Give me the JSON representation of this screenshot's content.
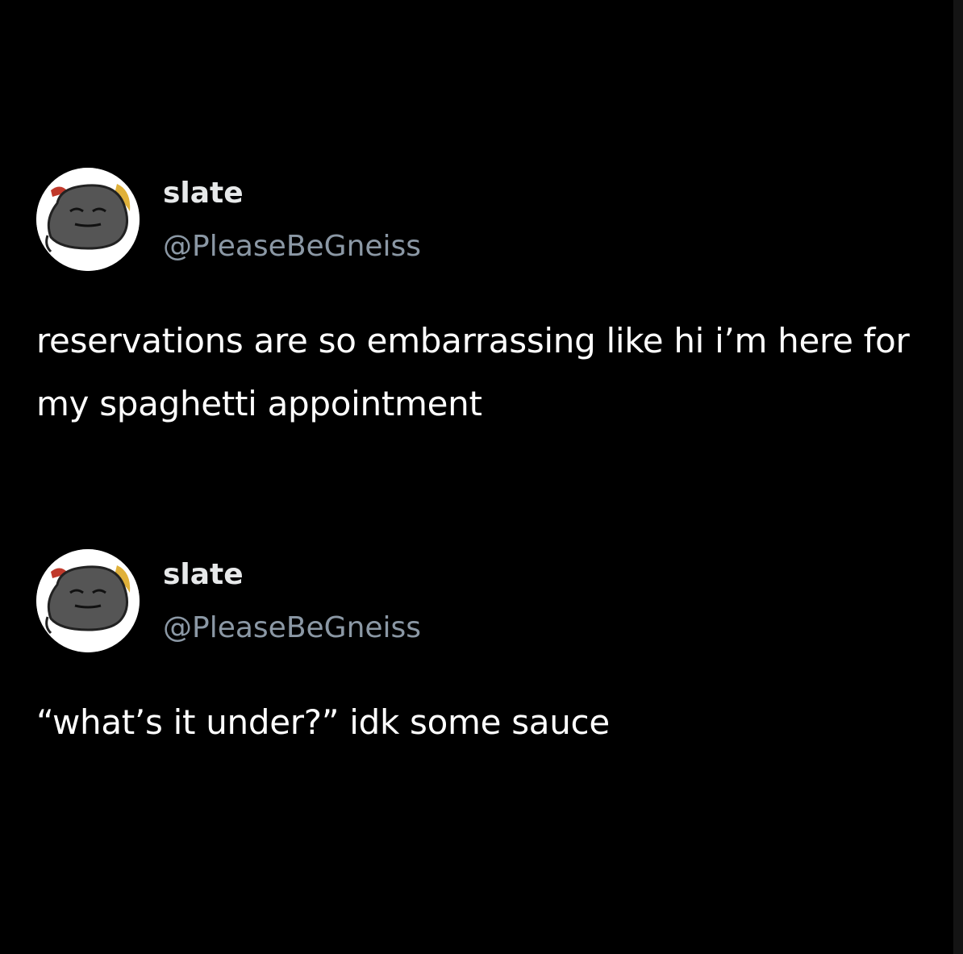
{
  "tweets": [
    {
      "display_name": "slate",
      "handle": "@PleaseBeGneiss",
      "avatar_icon": "rock-face-avatar-icon",
      "text": "reservations are so embarrassing like hi i’m here for my spaghetti appointment"
    },
    {
      "display_name": "slate",
      "handle": "@PleaseBeGneiss",
      "avatar_icon": "rock-face-avatar-icon",
      "text": "“what’s it under?” idk some sauce"
    }
  ],
  "colors": {
    "background": "#000000",
    "text": "#ffffff",
    "handle": "#8b98a5",
    "avatar_bg": "#ffffff"
  }
}
